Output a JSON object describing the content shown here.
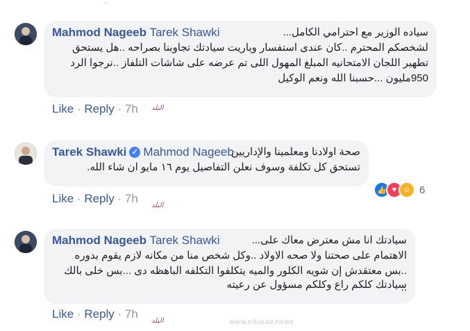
{
  "watermark": {
    "site": "www.elbalad.news",
    "brand": "صدى البلد"
  },
  "logo_text": "البلد",
  "comments": [
    {
      "author": "Mahmod Nageeb",
      "mention": "Tarek Shawki",
      "lines": [
        "سياده الوزير مع احترامي الكامل...",
        "لشخصكم المحترم ..كان عندى استفسار وياريت سيادتك تجاوبنا بصراحه ..هل يستحق",
        "تطهير اللجان الامتحانيه المبلغ المهول اللى تم عرضه على شاشات التلفاز ..نرجوا الرد",
        "950مليون ...حسبنا الله ونعم الوكيل"
      ],
      "like": "Like",
      "reply": "Reply",
      "time": "7h"
    },
    {
      "author": "Tarek Shawki",
      "verified": true,
      "mention": "Mahmod Nageeb",
      "lines": [
        "صحة اولادنا ومعلمينا والإداريين",
        "تستحق كل تكلفة وسوف نعلن التفاصيل يوم ١٦ مايو ان شاء الله."
      ],
      "reaction_count": "6",
      "like": "Like",
      "reply": "Reply",
      "time": "7h"
    },
    {
      "author": "Mahmod Nageeb",
      "mention": "Tarek Shawki",
      "lines": [
        "سيادتك انا مش معترض معاك على...",
        "الاهتمام على صحتنا ولا صحه الاولاد ..وكل شخص منا من مكانه لازم يقوم بدوره",
        "..بس معتقدش إن شويه الكلور والميه يتكلفوا التكلفه الباهظه دى ...بس خلى بالك",
        "سيادتك كلكم راع وكلكم مسؤول عن رعيته",
        ".."
      ],
      "like": "Like",
      "reply": "Reply",
      "time": "7h"
    }
  ]
}
